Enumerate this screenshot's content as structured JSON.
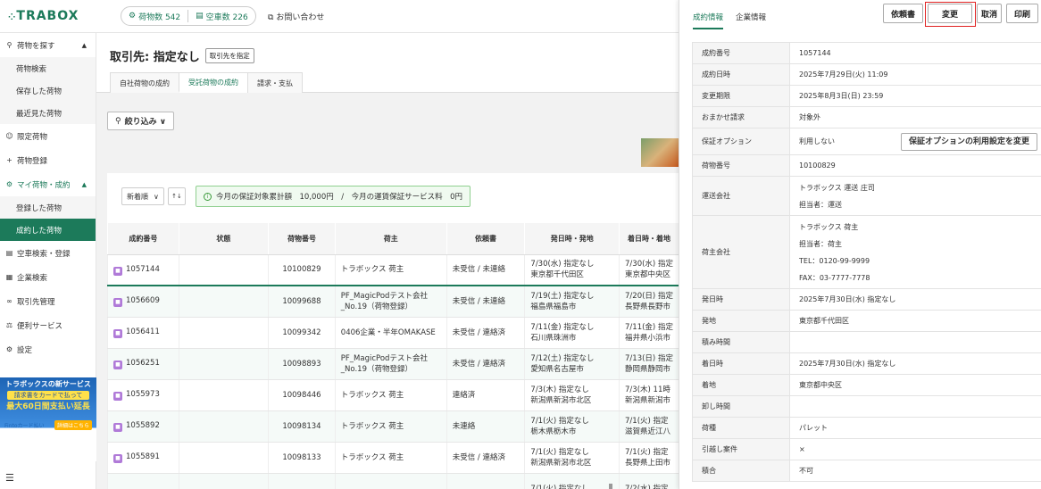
{
  "header": {
    "logo": "TRABOX",
    "cargo_count_label": "荷物数 542",
    "vehicle_count_label": "空車数 226",
    "contact_label": "お問い合わせ"
  },
  "sidebar": {
    "items": [
      {
        "label": "荷物を探す",
        "icon": "search-icon",
        "caret": "^"
      },
      {
        "label": "荷物検索",
        "sub": true
      },
      {
        "label": "保存した荷物",
        "sub": true
      },
      {
        "label": "最近見た荷物",
        "sub": true
      },
      {
        "label": "限定荷物",
        "icon": "user-icon"
      },
      {
        "label": "荷物登録",
        "icon": "plus-icon"
      },
      {
        "label": "マイ荷物・成約",
        "icon": "box-icon",
        "caret": "^"
      },
      {
        "label": "登録した荷物",
        "sub": true
      },
      {
        "label": "成約した荷物",
        "sub": true,
        "active": true
      },
      {
        "label": "空車検索・登録",
        "icon": "truck-icon"
      },
      {
        "label": "企業検索",
        "icon": "building-icon"
      },
      {
        "label": "取引先管理",
        "icon": "handshake-icon"
      },
      {
        "label": "便利サービス",
        "icon": "service-icon"
      },
      {
        "label": "設定",
        "icon": "gear-icon"
      }
    ],
    "banner": {
      "line1": "トラボックスの新サービス",
      "line2": "請求書をカードで払って",
      "line3": "最大60日間支払い延長",
      "brand": "Fintoカード払い",
      "cta": "詳細はこちら"
    }
  },
  "main": {
    "partner_title": "取引先: 指定なし",
    "partner_button": "取引先を指定",
    "tabs": [
      "自社荷物の成約",
      "受託荷物の成約",
      "請求・支払"
    ],
    "active_tab": 1,
    "filter_label": "絞り込み ∨",
    "sort_label": "新着順",
    "guarantee_text": "今月の保証対象累計額　10,000円　/　今月の運賃保証サービス料　0円",
    "columns": [
      "成約番号",
      "状態",
      "荷物番号",
      "荷主",
      "依頼書",
      "発日時・発地",
      "着日時・着地"
    ],
    "rows": [
      {
        "no": "1057144",
        "status": "",
        "cargo": "10100829",
        "shipper": "トラボックス 荷主",
        "req": "未受信 / 未連絡",
        "dep1": "7/30(水) 指定なし",
        "dep2": "東京都千代田区",
        "arr1": "7/30(水) 指定",
        "arr2": "東京都中央区"
      },
      {
        "no": "1056609",
        "status": "",
        "cargo": "10099688",
        "shipper": "PF_MagicPodテスト会社",
        "shipper2": "_No.19（荷物登録）",
        "req": "未受信 / 未連絡",
        "dep1": "7/19(土) 指定なし",
        "dep2": "福島県福島市",
        "arr1": "7/20(日) 指定",
        "arr2": "長野県長野市"
      },
      {
        "no": "1056411",
        "status": "",
        "cargo": "10099342",
        "shipper": "0406企業・半年OMAKASE",
        "req": "未受信 / 連絡済",
        "dep1": "7/11(金) 指定なし",
        "dep2": "石川県珠洲市",
        "arr1": "7/11(金) 指定",
        "arr2": "福井県小浜市"
      },
      {
        "no": "1056251",
        "status": "",
        "cargo": "10098893",
        "shipper": "PF_MagicPodテスト会社",
        "shipper2": "_No.19（荷物登録）",
        "req": "未受信 / 連絡済",
        "dep1": "7/12(土) 指定なし",
        "dep2": "愛知県名古屋市",
        "arr1": "7/13(日) 指定",
        "arr2": "静岡県静岡市"
      },
      {
        "no": "1055973",
        "status": "",
        "cargo": "10098446",
        "shipper": "トラボックス 荷主",
        "req": "連絡済",
        "dep1": "7/3(木) 指定なし",
        "dep2": "新潟県新潟市北区",
        "arr1": "7/3(木) 11時",
        "arr2": "新潟県新潟市"
      },
      {
        "no": "1055892",
        "status": "",
        "cargo": "10098134",
        "shipper": "トラボックス 荷主",
        "req": "未連絡",
        "dep1": "7/1(火) 指定なし",
        "dep2": "栃木県栃木市",
        "arr1": "7/1(火) 指定",
        "arr2": "滋賀県近江八"
      },
      {
        "no": "1055891",
        "status": "",
        "cargo": "10098133",
        "shipper": "トラボックス 荷主",
        "req": "未受信 / 連絡済",
        "dep1": "7/1(火) 指定なし",
        "dep2": "新潟県新潟市北区",
        "arr1": "7/1(火) 指定",
        "arr2": "長野県上田市"
      },
      {
        "no": "",
        "status": "",
        "cargo": "",
        "shipper": "",
        "req": "",
        "dep1": "7/1(火) 指定なし",
        "dep2": "",
        "arr1": "7/2(水) 指定",
        "arr2": ""
      }
    ]
  },
  "panel": {
    "tabs": [
      "成約情報",
      "企業情報"
    ],
    "buttons": {
      "request": "依頼書",
      "change": "変更",
      "cancel": "取消",
      "print": "印刷"
    },
    "guarantee_button": "保証オプションの利用設定を変更",
    "details": [
      {
        "k": "成約番号",
        "v": [
          "1057144"
        ]
      },
      {
        "k": "成約日時",
        "v": [
          "2025年7月29日(火) 11:09"
        ]
      },
      {
        "k": "変更期限",
        "v": [
          "2025年8月3日(日) 23:59"
        ]
      },
      {
        "k": "おまかせ請求",
        "v": [
          "対象外"
        ]
      },
      {
        "k": "保証オプション",
        "v": [
          "利用しない"
        ],
        "button": true
      },
      {
        "k": "荷物番号",
        "v": [
          "10100829"
        ]
      },
      {
        "k": "運送会社",
        "v": [
          "トラボックス 運送 庄司",
          "担当者：運送"
        ]
      },
      {
        "k": "荷主会社",
        "v": [
          "トラボックス 荷主",
          "担当者：荷主",
          "TEL：0120-99-9999",
          "FAX：03-7777-7778"
        ]
      },
      {
        "k": "発日時",
        "v": [
          "2025年7月30日(水) 指定なし"
        ]
      },
      {
        "k": "発地",
        "v": [
          "東京都千代田区"
        ]
      },
      {
        "k": "積み時間",
        "v": [
          ""
        ]
      },
      {
        "k": "着日時",
        "v": [
          "2025年7月30日(水) 指定なし"
        ]
      },
      {
        "k": "着地",
        "v": [
          "東京都中央区"
        ]
      },
      {
        "k": "卸し時間",
        "v": [
          ""
        ]
      },
      {
        "k": "荷種",
        "v": [
          "パレット"
        ]
      },
      {
        "k": "引越し案件",
        "v": [
          "×"
        ]
      },
      {
        "k": "積合",
        "v": [
          "不可"
        ]
      }
    ]
  }
}
